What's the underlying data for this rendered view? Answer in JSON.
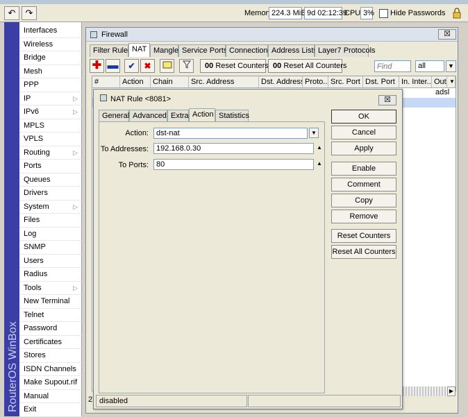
{
  "topbar": {
    "memory_label": "Memory:",
    "memory_value": "224.3 MiB",
    "uptime": "9d 02:12:39",
    "cpu_label": "CPU:",
    "cpu_value": "3%",
    "hide_passwords_label": "Hide Passwords",
    "hide_passwords_checked": false,
    "undo_icon": "undo-icon",
    "redo_icon": "redo-icon",
    "lock_icon": "lock-icon"
  },
  "banner": {
    "text": "RouterOS WinBox"
  },
  "menu": {
    "items": [
      {
        "label": "Interfaces",
        "submenu": false
      },
      {
        "label": "Wireless",
        "submenu": false
      },
      {
        "label": "Bridge",
        "submenu": false
      },
      {
        "label": "Mesh",
        "submenu": false
      },
      {
        "label": "PPP",
        "submenu": false
      },
      {
        "label": "IP",
        "submenu": true
      },
      {
        "label": "IPv6",
        "submenu": true
      },
      {
        "label": "MPLS",
        "submenu": false
      },
      {
        "label": "VPLS",
        "submenu": false
      },
      {
        "label": "Routing",
        "submenu": true
      },
      {
        "label": "Ports",
        "submenu": false
      },
      {
        "label": "Queues",
        "submenu": false
      },
      {
        "label": "Drivers",
        "submenu": false
      },
      {
        "label": "System",
        "submenu": true
      },
      {
        "label": "Files",
        "submenu": false
      },
      {
        "label": "Log",
        "submenu": false
      },
      {
        "label": "SNMP",
        "submenu": false
      },
      {
        "label": "Users",
        "submenu": false
      },
      {
        "label": "Radius",
        "submenu": false
      },
      {
        "label": "Tools",
        "submenu": true
      },
      {
        "label": "New Terminal",
        "submenu": false
      },
      {
        "label": "Telnet",
        "submenu": false
      },
      {
        "label": "Password",
        "submenu": false
      },
      {
        "label": "Certificates",
        "submenu": false
      },
      {
        "label": "Stores",
        "submenu": false
      },
      {
        "label": "ISDN Channels",
        "submenu": false
      },
      {
        "label": "Make Supout.rif",
        "submenu": false
      },
      {
        "label": "Manual",
        "submenu": false
      },
      {
        "label": "Exit",
        "submenu": false
      }
    ]
  },
  "firewall": {
    "title": "Firewall",
    "close_label": "☒",
    "tabs": [
      "Filter Rules",
      "NAT",
      "Mangle",
      "Service Ports",
      "Connections",
      "Address Lists",
      "Layer7 Protocols"
    ],
    "active_tab": "NAT",
    "toolbar": {
      "reset_counters": "Reset Counters",
      "reset_all_counters": "Reset All Counters",
      "counter_prefix": "00",
      "find_placeholder": "Find",
      "filter_value": "all"
    },
    "columns": [
      "#",
      "Action",
      "Chain",
      "Src. Address",
      "Dst. Address",
      "Proto...",
      "Src. Port",
      "Dst. Port",
      "In. Inter...",
      "Out"
    ],
    "row_out_value": "adsl",
    "footer_count": "2"
  },
  "nat_dialog": {
    "title": "NAT Rule <8081>",
    "close_label": "☒",
    "tabs": [
      "General",
      "Advanced",
      "Extra",
      "Action",
      "Statistics"
    ],
    "active_tab": "Action",
    "fields": {
      "action_label": "Action:",
      "action_value": "dst-nat",
      "to_addresses_label": "To Addresses:",
      "to_addresses_value": "192.168.0.30",
      "to_ports_label": "To Ports:",
      "to_ports_value": "80"
    },
    "buttons": {
      "ok": "OK",
      "cancel": "Cancel",
      "apply": "Apply",
      "enable": "Enable",
      "comment": "Comment",
      "copy": "Copy",
      "remove": "Remove",
      "reset_counters": "Reset Counters",
      "reset_all_counters": "Reset All Counters"
    },
    "status": "disabled"
  },
  "colors": {
    "banner": "#3b3ea4",
    "add_icon": "#cc0000",
    "remove_icon": "#1a3a9a",
    "enable_icon": "#1a3a9a",
    "disable_icon": "#cc0000",
    "selected_row": "#c7d8f4"
  }
}
